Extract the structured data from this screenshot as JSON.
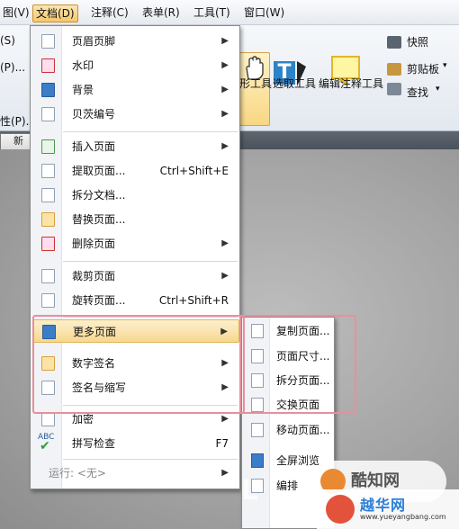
{
  "menubar": {
    "items": [
      {
        "label": "图(V)"
      },
      {
        "label": "文档(D)"
      },
      {
        "label": "注释(C)"
      },
      {
        "label": "表单(R)"
      },
      {
        "label": "工具(T)"
      },
      {
        "label": "窗口(W)"
      }
    ]
  },
  "ribbon": {
    "left_fragments": [
      "(S)",
      "(P)...",
      "性(P)..."
    ],
    "tool_labels": {
      "hand": "形工具",
      "select": "选取工具",
      "note": "编辑注释工具"
    },
    "right_buttons": {
      "snapshot": "快照",
      "clipboard": "剪贴板",
      "find": "查找"
    }
  },
  "tab": {
    "label": "新建"
  },
  "menu": {
    "items": [
      {
        "label": "页眉页脚",
        "shortcut": "",
        "submenu": true
      },
      {
        "label": "水印",
        "shortcut": "",
        "submenu": true
      },
      {
        "label": "背景",
        "shortcut": "",
        "submenu": true
      },
      {
        "label": "贝茨编号",
        "shortcut": "",
        "submenu": true
      },
      {
        "label": "插入页面",
        "shortcut": "",
        "submenu": true
      },
      {
        "label": "提取页面...",
        "shortcut": "Ctrl+Shift+E",
        "submenu": false
      },
      {
        "label": "拆分文档...",
        "shortcut": "",
        "submenu": false
      },
      {
        "label": "替换页面...",
        "shortcut": "",
        "submenu": false
      },
      {
        "label": "删除页面",
        "shortcut": "",
        "submenu": true
      },
      {
        "label": "裁剪页面",
        "shortcut": "",
        "submenu": true
      },
      {
        "label": "旋转页面...",
        "shortcut": "Ctrl+Shift+R",
        "submenu": false
      },
      {
        "label": "更多页面",
        "shortcut": "",
        "submenu": true
      },
      {
        "label": "数字签名",
        "shortcut": "",
        "submenu": true
      },
      {
        "label": "签名与缩写",
        "shortcut": "",
        "submenu": true
      },
      {
        "label": "加密",
        "shortcut": "",
        "submenu": true
      },
      {
        "label": "拼写检查",
        "shortcut": "F7",
        "submenu": false
      },
      {
        "label": "运行: <无>",
        "shortcut": "",
        "submenu": true
      }
    ],
    "spell_icon_text": "ABC"
  },
  "submenu": {
    "items": [
      {
        "label": "复制页面..."
      },
      {
        "label": "页面尺寸..."
      },
      {
        "label": "拆分页面..."
      },
      {
        "label": "交换页面"
      },
      {
        "label": "移动页面..."
      },
      {
        "label": "全屏浏览"
      },
      {
        "label": "编排"
      }
    ]
  },
  "watermark": {
    "logo_text": "酷知网",
    "site_name": "越华网",
    "site_url": "www.yueyangbang.com"
  }
}
